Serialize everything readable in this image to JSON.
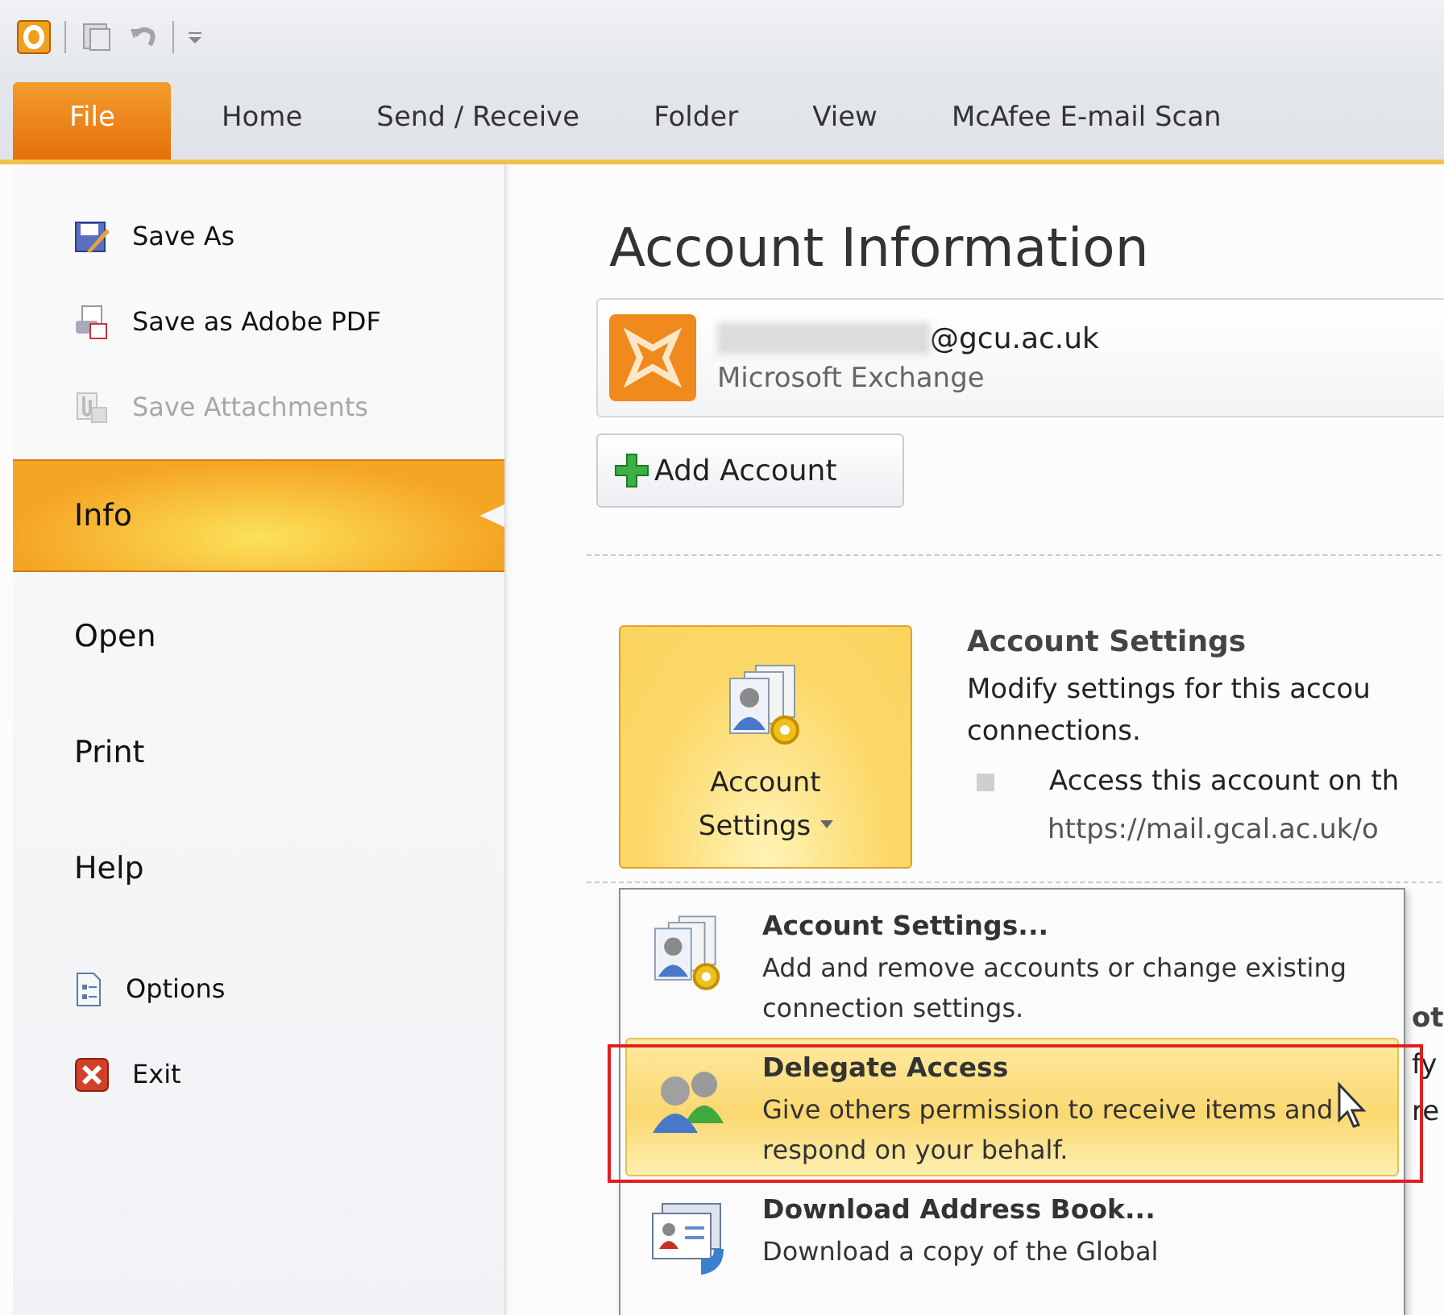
{
  "tabs": [
    {
      "label": "File",
      "selected": true
    },
    {
      "label": "Home",
      "selected": false
    },
    {
      "label": "Send / Receive",
      "selected": false
    },
    {
      "label": "Folder",
      "selected": false
    },
    {
      "label": "View",
      "selected": false
    },
    {
      "label": "McAfee E-mail Scan",
      "selected": false
    }
  ],
  "sidebar": {
    "items": [
      {
        "label": "Save As",
        "kind": "command",
        "selected": false,
        "disabled": false
      },
      {
        "label": "Save as Adobe PDF",
        "kind": "command",
        "selected": false,
        "disabled": false
      },
      {
        "label": "Save Attachments",
        "kind": "command",
        "selected": false,
        "disabled": true
      },
      {
        "label": "Info",
        "kind": "page",
        "selected": true,
        "disabled": false
      },
      {
        "label": "Open",
        "kind": "page",
        "selected": false,
        "disabled": false
      },
      {
        "label": "Print",
        "kind": "page",
        "selected": false,
        "disabled": false
      },
      {
        "label": "Help",
        "kind": "page",
        "selected": false,
        "disabled": false
      },
      {
        "label": "Options",
        "kind": "command",
        "selected": false,
        "disabled": false
      },
      {
        "label": "Exit",
        "kind": "command",
        "selected": false,
        "disabled": false
      }
    ]
  },
  "account": {
    "title": "Account Information",
    "address": "@gcu.ac.uk",
    "type": "Microsoft Exchange",
    "add_button": "Add Account"
  },
  "account_settings": {
    "button": "Account Settings",
    "heading": "Account Settings",
    "description_lines": [
      "Modify settings for this accou",
      "connections."
    ],
    "bullet": "Access this account on th",
    "url": "https://mail.gcal.ac.uk/o"
  },
  "menu": {
    "items": [
      {
        "title": "Account Settings...",
        "description": "Add and remove accounts or change existing connection settings.",
        "selected": false
      },
      {
        "title": "Delegate Access",
        "description": "Give others permission to receive items and respond on your behalf.",
        "selected": true
      },
      {
        "title": "Download Address Book...",
        "description": "Download a copy of the Global",
        "selected": false
      }
    ]
  },
  "hidden_fragments": [
    "ot",
    "fy",
    "re"
  ]
}
